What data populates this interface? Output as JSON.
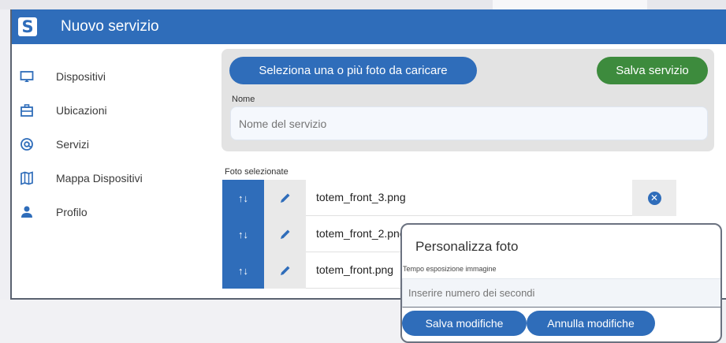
{
  "app": {
    "logo_letter": "S",
    "title": "Nuovo servizio"
  },
  "sidebar": {
    "items": [
      {
        "label": "Dispositivi",
        "icon": "monitor-icon"
      },
      {
        "label": "Ubicazioni",
        "icon": "briefcase-icon"
      },
      {
        "label": "Servizi",
        "icon": "at-icon"
      },
      {
        "label": "Mappa Dispositivi",
        "icon": "map-icon"
      },
      {
        "label": "Profilo",
        "icon": "person-icon"
      }
    ]
  },
  "main": {
    "upload_button": "Seleziona una o più foto da caricare",
    "save_button": "Salva servizio",
    "name_label": "Nome",
    "name_placeholder": "Nome del servizio",
    "selected_label": "Foto selezionate",
    "photos": [
      {
        "name": "totem_front_3.png"
      },
      {
        "name": "totem_front_2.png"
      },
      {
        "name": "totem_front.png"
      }
    ],
    "sort_glyph": "↑↓"
  },
  "dialog": {
    "title": "Personalizza foto",
    "exposure_label": "Tempo esposizione immagine",
    "exposure_placeholder": "Inserire numero dei secondi",
    "save_button": "Salva modifiche",
    "cancel_button": "Annulla modifiche"
  },
  "colors": {
    "primary": "#2f6dba",
    "success": "#3d8b3d",
    "panel": "#e3e3e3"
  }
}
